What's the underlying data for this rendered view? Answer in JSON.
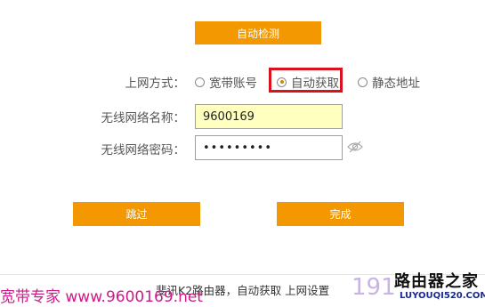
{
  "top_button": {
    "label": "自动检测"
  },
  "connection": {
    "label": "上网方式：",
    "options": [
      {
        "label": "宽带账号",
        "selected": false
      },
      {
        "label": "自动获取",
        "selected": true
      },
      {
        "label": "静态地址",
        "selected": false
      }
    ]
  },
  "wifi_name": {
    "label": "无线网络名称：",
    "value": "9600169"
  },
  "wifi_password": {
    "label": "无线网络密码：",
    "value": "•••••••••"
  },
  "buttons": {
    "skip": "跳过",
    "finish": "完成"
  },
  "caption": "斐讯K2路由器，自动获取 上网设置",
  "watermarks": {
    "left": "宽带专家 www.9600169.net",
    "number": "191",
    "logo_cn": "路由器之家",
    "logo_en": "LUYOUQI520.COM"
  },
  "colors": {
    "accent": "#f39800",
    "highlight": "#d8131b",
    "field_fill": "#ffffc0"
  },
  "icons": {
    "password_toggle": "eye-icon"
  }
}
